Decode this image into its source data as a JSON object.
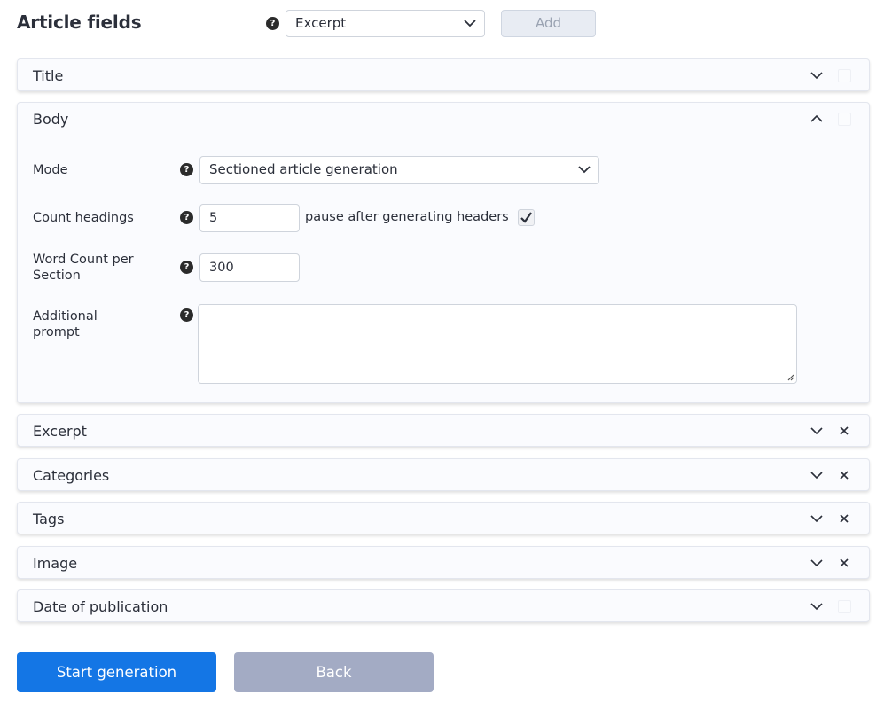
{
  "header": {
    "title": "Article fields",
    "help": "?",
    "field_select_value": "Excerpt",
    "add_label": "Add"
  },
  "panels": [
    {
      "title": "Title",
      "removable": false,
      "expanded": false
    },
    {
      "title": "Body",
      "removable": false,
      "expanded": true
    },
    {
      "title": "Excerpt",
      "removable": true,
      "expanded": false
    },
    {
      "title": "Categories",
      "removable": true,
      "expanded": false
    },
    {
      "title": "Tags",
      "removable": true,
      "expanded": false
    },
    {
      "title": "Image",
      "removable": true,
      "expanded": false
    },
    {
      "title": "Date of publication",
      "removable": false,
      "expanded": false
    }
  ],
  "body": {
    "mode_label": "Mode",
    "mode_value": "Sectioned article generation",
    "count_headings_label": "Count headings",
    "count_headings_value": "5",
    "pause_label": "pause after generating headers",
    "pause_checked": true,
    "word_count_label_line1": "Word Count per",
    "word_count_label_line2": "Section",
    "word_count_value": "300",
    "additional_prompt_label_line1": "Additional",
    "additional_prompt_label_line2": "prompt",
    "additional_prompt_value": ""
  },
  "footer": {
    "start_label": "Start generation",
    "back_label": "Back"
  },
  "colors": {
    "primary": "#1476e5",
    "secondary": "#a3abc4",
    "panel_bg": "#fafbfe"
  }
}
